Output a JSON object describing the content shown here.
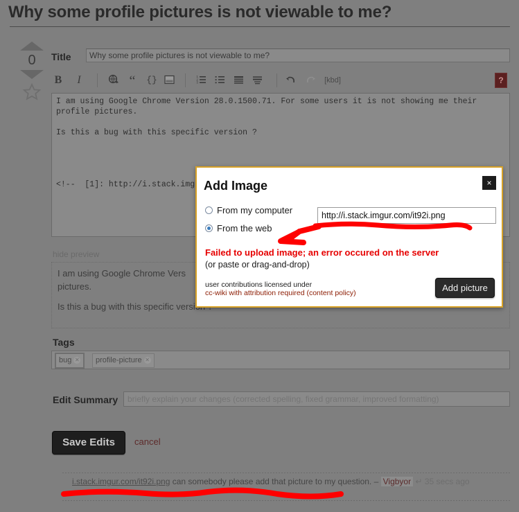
{
  "page": {
    "title": "Why some profile pictures is not viewable to me?"
  },
  "votes": {
    "count": "0",
    "up_icon": "triangle-up-icon",
    "down_icon": "triangle-down-icon",
    "favorite_icon": "star-outline-icon"
  },
  "form": {
    "title_label": "Title",
    "title_value": "Why some profile pictures is not viewable to me?",
    "body_line1": "I am using Google Chrome Version 28.0.1500.71. For some users it is not showing me their",
    "body_line2": "profile pictures.",
    "body_line3": "Is this a bug with this specific version ?",
    "body_line4": "<!--  [1]: http://i.stack.img"
  },
  "toolbar": {
    "bold": "B",
    "italic": "I",
    "link_icon": "hyperlink-globe-icon",
    "quote": "“",
    "code": "{}",
    "image_icon": "insert-image-icon",
    "numbered_list_icon": "numbered-list-icon",
    "bullet_list_icon": "bullet-list-icon",
    "heading_icon": "heading-icon",
    "hr_icon": "horizontal-rule-icon",
    "undo_icon": "undo-arrow-icon",
    "redo_icon": "redo-arrow-icon",
    "kbd": "[kbd]",
    "help": "?"
  },
  "preview": {
    "toggle_label": "hide preview",
    "para1": "I am using Google Chrome Vers",
    "para1b": "pictures.",
    "para2": "Is this a bug with this specific version ?"
  },
  "tags": {
    "label": "Tags",
    "items": [
      {
        "name": "bug",
        "remove_icon": "remove-tag-icon",
        "selected": true
      },
      {
        "name": "profile-picture",
        "remove_icon": "remove-tag-icon",
        "selected": false
      }
    ]
  },
  "summary": {
    "label": "Edit Summary",
    "placeholder": "briefly explain your changes (corrected spelling, fixed grammar, improved formatting)"
  },
  "actions": {
    "save_label": "Save Edits",
    "cancel_label": "cancel"
  },
  "comment": {
    "link_text": "i.stack.imgur.com/it92i.png",
    "text": " can somebody please add that picture to my question. ",
    "dash": "–",
    "user": "Vigbyor",
    "reply_icon": "reply-arrow-icon",
    "when": "35 secs ago",
    "ghost": "ago"
  },
  "dialog": {
    "title": "Add Image",
    "close_icon": "close-icon",
    "close_label": "×",
    "option_computer": "From my computer",
    "option_web": "From the web",
    "selected_option": "From the web",
    "url_value": "http://i.stack.imgur.com/it92i.png",
    "error": "Failed to upload image; an error occured on the server",
    "hint": "(or paste or drag-and-drop)",
    "license_line1": "user contributions licensed under",
    "license_line2": "cc-wiki with attribution required (content policy)",
    "submit_label": "Add picture"
  },
  "colors": {
    "page_bg": "#7f7f7f",
    "dialog_border": "#d8a227",
    "error_red": "#e60000",
    "annotation_red": "#fe0000",
    "button_dark": "#1e1e1e",
    "link_maroon": "#8b1a00"
  },
  "annotations": {
    "arrow_note": "red hand-drawn arrow pointing from the URL field down-left toward the error message",
    "underline_note": "red hand-drawn underline beneath the bottom comment"
  }
}
